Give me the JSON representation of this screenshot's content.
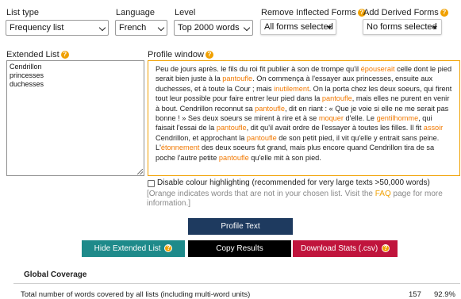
{
  "filters": {
    "list_type": {
      "label": "List type",
      "value": "Frequency list"
    },
    "language": {
      "label": "Language",
      "value": "French"
    },
    "level": {
      "label": "Level",
      "value": "Top 2000 words"
    },
    "remove_inflected": {
      "label": "Remove Inflected Forms",
      "value": "All forms selected"
    },
    "add_derived": {
      "label": "Add Derived Forms",
      "value": "No forms selected"
    }
  },
  "extended_list": {
    "label": "Extended List",
    "items": [
      "Cendrillon",
      "princesses",
      "duchesses"
    ]
  },
  "profile_window": {
    "label": "Profile window",
    "segments": [
      {
        "t": "Peu de jours après. le fils du roi fit publier à son de trompe qu'il "
      },
      {
        "t": "épouserait",
        "w": true
      },
      {
        "t": " celle dont le pied serait bien juste à la "
      },
      {
        "t": "pantoufle",
        "w": true
      },
      {
        "t": ". On commença à l'essayer aux princesses, ensuite aux duchesses, et à toute la Cour ; mais "
      },
      {
        "t": "inutilement",
        "w": true
      },
      {
        "t": ". On la porta chez les deux soeurs, qui firent tout leur possible pour faire entrer leur pied dans la "
      },
      {
        "t": "pantoufle",
        "w": true
      },
      {
        "t": ", mais elles ne purent en venir à bout. Cendrillon reconnut sa "
      },
      {
        "t": "pantoufle",
        "w": true
      },
      {
        "t": ", dit en riant : « Que je voie si elle ne me serait pas bonne ! » Ses deux soeurs se mirent à rire et à se "
      },
      {
        "t": "moquer",
        "w": true
      },
      {
        "t": " d'elle. Le "
      },
      {
        "t": "gentilhomme",
        "w": true
      },
      {
        "t": ", qui faisait l'essai de la "
      },
      {
        "t": "pantoufle",
        "w": true
      },
      {
        "t": ", dit qu'il avait ordre de l'essayer à toutes les filles. Il fit "
      },
      {
        "t": "assoir",
        "w": true
      },
      {
        "t": " Cendrillon, et approchant la "
      },
      {
        "t": "pantoufle",
        "w": true
      },
      {
        "t": " de son petit pied, il vit qu'elle y entrait sans peine. L'"
      },
      {
        "t": "étonnement",
        "w": true
      },
      {
        "t": " des deux soeurs fut grand, mais plus encore quand Cendrillon tira de sa poche l'autre petite "
      },
      {
        "t": "pantoufle",
        "w": true
      },
      {
        "t": " qu'elle mit à son pied."
      }
    ]
  },
  "highlight": {
    "checkbox_label": "Disable colour highlighting (recommended for very large texts >50,000 words)",
    "checked": false,
    "note_before": "[Orange indicates words that are not in your chosen list. Visit the ",
    "note_link": "FAQ",
    "note_after": " page for more information.]"
  },
  "buttons": {
    "profile_text": "Profile Text",
    "hide_extended": "Hide Extended List",
    "copy_results": "Copy Results",
    "download_stats": "Download Stats (.csv)"
  },
  "coverage": {
    "title": "Global Coverage",
    "row_label": "Total number of words covered by all lists (including multi-word units)",
    "count": "157",
    "percent": "92.9%"
  },
  "colors": {
    "accent_orange": "#f07800",
    "profile_button": "#1e3a5f",
    "hide_button": "#1e8a8a",
    "copy_button": "#000000",
    "download_button": "#c0143c"
  }
}
